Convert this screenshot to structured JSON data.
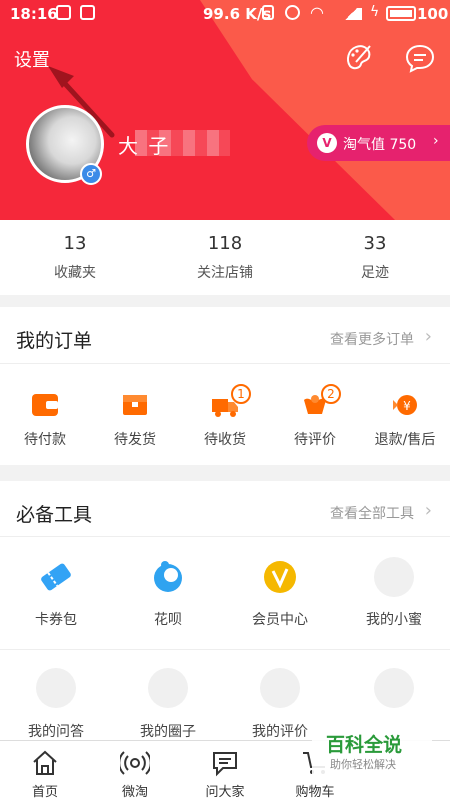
{
  "status_bar": {
    "time": "18:16",
    "speed": "99.6 K/s",
    "battery": "100"
  },
  "header": {
    "settings_label": "设置",
    "username": "大              子",
    "taoqi_label": "淘气值 750",
    "taoqi_icon": "V",
    "icons": [
      "palette-icon",
      "message-icon",
      "gender-male-icon"
    ],
    "colors": {
      "header_red": "#f5283a",
      "pill_pink": "#e6226e",
      "annotation_arrow": "#a0141e"
    }
  },
  "stats": [
    {
      "value": "13",
      "label": "收藏夹"
    },
    {
      "value": "118",
      "label": "关注店铺"
    },
    {
      "value": "33",
      "label": "足迹"
    }
  ],
  "orders": {
    "title": "我的订单",
    "more": "查看更多订单",
    "items": [
      {
        "label": "待付款",
        "icon": "wallet-icon"
      },
      {
        "label": "待发货",
        "icon": "box-icon"
      },
      {
        "label": "待收货",
        "icon": "truck-icon",
        "badge": "1"
      },
      {
        "label": "待评价",
        "icon": "review-icon",
        "badge": "2"
      },
      {
        "label": "退款/售后",
        "icon": "refund-icon"
      }
    ]
  },
  "tools": {
    "title": "必备工具",
    "more": "查看全部工具",
    "row1": [
      {
        "label": "卡券包",
        "icon": "coupon-icon"
      },
      {
        "label": "花呗",
        "icon": "huabei-icon"
      },
      {
        "label": "会员中心",
        "icon": "vip-icon"
      },
      {
        "label": "我的小蜜",
        "icon": "placeholder-icon"
      }
    ],
    "row2": [
      {
        "label": "我的问答"
      },
      {
        "label": "我的圈子"
      },
      {
        "label": "我的评价"
      },
      {
        "label": ""
      }
    ]
  },
  "watermark": {
    "title": "百科全说",
    "subtitle": "助你轻松解决"
  },
  "tabbar": [
    {
      "label": "首页",
      "icon": "home-icon"
    },
    {
      "label": "微淘",
      "icon": "broadcast-icon"
    },
    {
      "label": "问大家",
      "icon": "chat-icon"
    },
    {
      "label": "购物车",
      "icon": "cart-icon"
    }
  ]
}
